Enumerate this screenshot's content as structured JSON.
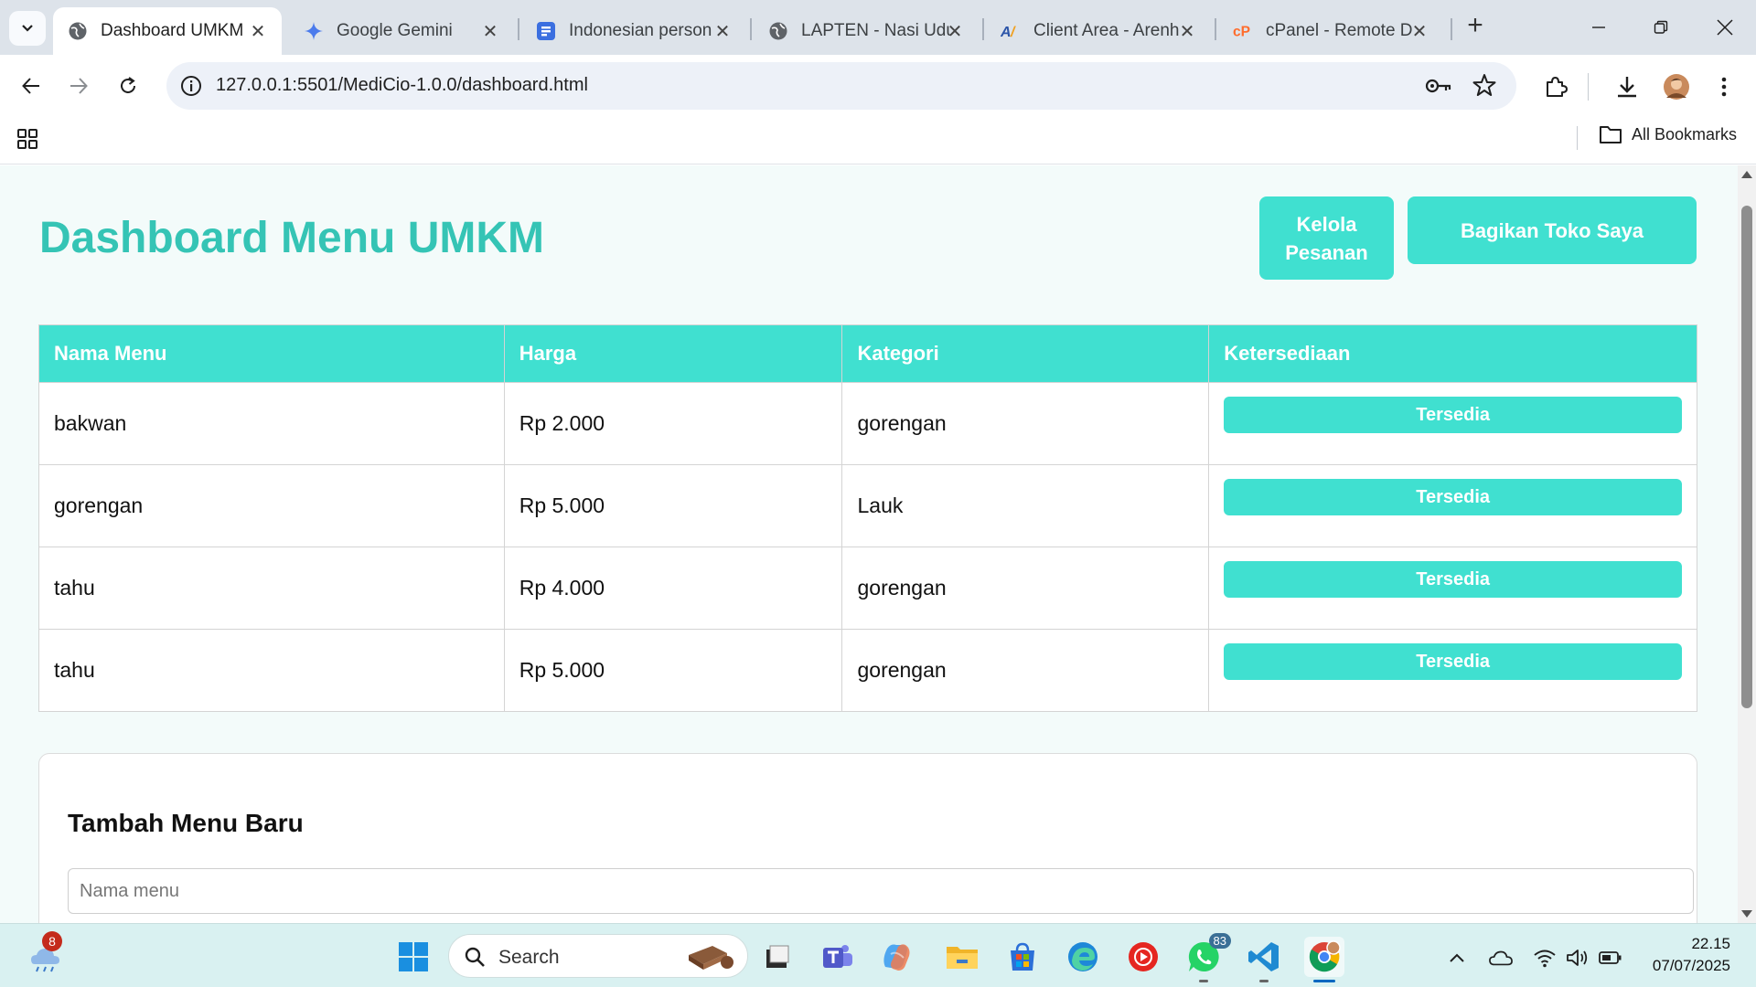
{
  "browser": {
    "tabs": [
      {
        "title": "Dashboard UMKM",
        "icon": "globe-icon",
        "active": true
      },
      {
        "title": "Google Gemini",
        "icon": "gemini-icon",
        "active": false
      },
      {
        "title": "Indonesian person",
        "icon": "forms-icon",
        "active": false
      },
      {
        "title": "LAPTEN - Nasi Udu",
        "icon": "globe-icon",
        "active": false
      },
      {
        "title": "Client Area - Arenh",
        "icon": "arenhost-icon",
        "active": false
      },
      {
        "title": "cPanel - Remote D",
        "icon": "cpanel-icon",
        "active": false
      }
    ],
    "url": "127.0.0.1:5501/MediCio-1.0.0/dashboard.html",
    "bookmarks_label": "All Bookmarks"
  },
  "page": {
    "title": "Dashboard Menu UMKM",
    "buttons": {
      "kelola": "Kelola Pesanan",
      "bagikan": "Bagikan Toko Saya"
    },
    "table": {
      "headers": [
        "Nama Menu",
        "Harga",
        "Kategori",
        "Ketersediaan"
      ],
      "rows": [
        {
          "nama": "bakwan",
          "harga": "Rp 2.000",
          "kategori": "gorengan",
          "status": "Tersedia"
        },
        {
          "nama": "gorengan",
          "harga": "Rp 5.000",
          "kategori": "Lauk",
          "status": "Tersedia"
        },
        {
          "nama": "tahu",
          "harga": "Rp 4.000",
          "kategori": "gorengan",
          "status": "Tersedia"
        },
        {
          "nama": "tahu",
          "harga": "Rp 5.000",
          "kategori": "gorengan",
          "status": "Tersedia"
        }
      ]
    },
    "form": {
      "title": "Tambah Menu Baru",
      "name_placeholder": "Nama menu",
      "name_value": ""
    }
  },
  "colors": {
    "accent": "#40e0d0",
    "title": "#35c4b5",
    "page_bg": "#f3fbfa"
  },
  "taskbar": {
    "widget_badge": "8",
    "search_label": "Search",
    "whatsapp_badge": "83",
    "time": "22.15",
    "date": "07/07/2025"
  }
}
